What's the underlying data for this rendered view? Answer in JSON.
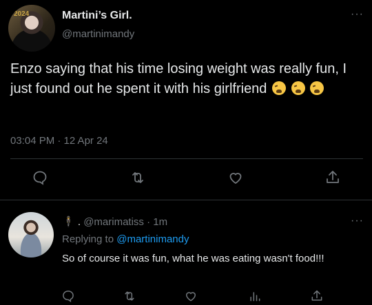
{
  "tweet": {
    "author_name": "Martini’s Girl.",
    "author_handle": "@martinimandy",
    "avatar_badge_text": "2024",
    "text": "Enzo saying that his time losing weight was really fun, I just found out he spent it with his girlfriend",
    "timestamp": "03:04 PM · 12 Apr 24",
    "more_label": "···",
    "actions": [
      "reply-icon",
      "retweet-icon",
      "like-icon",
      "share-icon"
    ]
  },
  "reply": {
    "author_prefix": "🕴 .",
    "author_handle": "@marimatiss",
    "time": "· 1m",
    "replying_prefix": "Replying to",
    "replying_to": "@martinimandy",
    "text": "So of course it was fun, what he was eating wasn't food!!!",
    "more_label": "···",
    "actions": [
      "reply-icon",
      "retweet-icon",
      "like-icon",
      "views-icon",
      "share-icon"
    ]
  },
  "colors": {
    "background": "#000000",
    "text": "#e7e9ea",
    "muted": "#71767b",
    "link": "#1d9bf0",
    "divider": "#2f3336"
  }
}
